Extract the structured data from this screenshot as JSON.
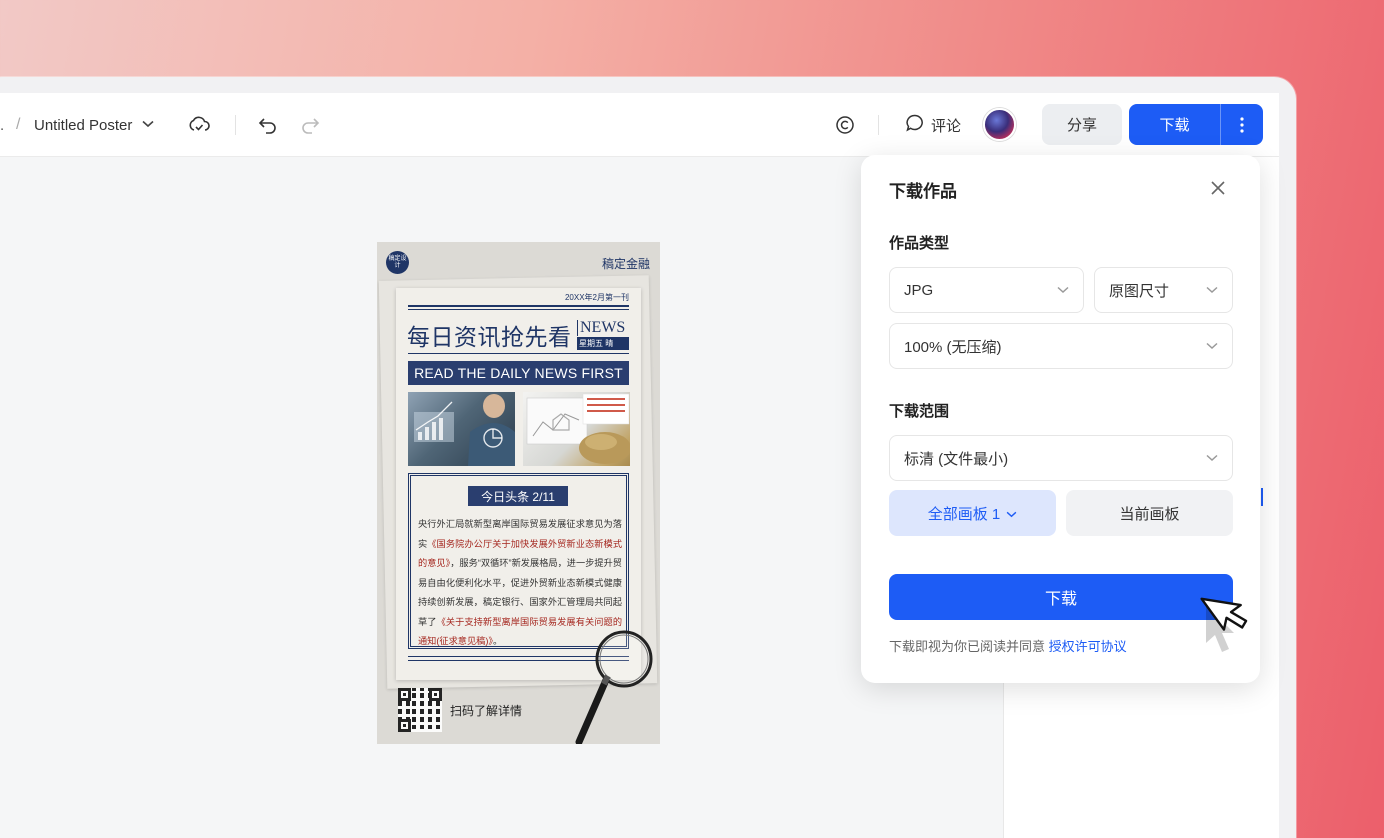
{
  "toolbar": {
    "breadcrumb_dot": ".",
    "breadcrumb_sep": "/",
    "title": "Untitled Poster",
    "comment_label": "评论",
    "share_label": "分享",
    "download_label": "下载"
  },
  "poster": {
    "logo_text": "稿定设计",
    "brand": "稿定金融",
    "issue": "20XX年2月第一刊",
    "headline": "每日资讯抢先看",
    "news_word": "NEWS",
    "news_sub": "星期五 晴",
    "banner": "READ THE DAILY NEWS FIRST",
    "today_label": "今日头条 2/11",
    "body_1": "央行外汇局就新型离岸国际贸易发展征求意见为落实",
    "body_red_1": "《国务院办公厅关于加快发展外贸新业态新模式的意见》",
    "body_2": "，服务“双循环”新发展格局，进一步提升贸易自由化便利化水平，促进外贸新业态新模式健康持续创新发展，稿定银行、国家外汇管理局共同起草了",
    "body_red_2": "《关于支持新型离岸国际贸易发展有关问题的通知(征求意见稿)》",
    "body_3": "。",
    "scan_label": "扫码了解详情"
  },
  "download_panel": {
    "title": "下载作品",
    "type_label": "作品类型",
    "format": "JPG",
    "size": "原图尺寸",
    "quality": "100% (无压缩)",
    "range_label": "下载范围",
    "resolution": "标清 (文件最小)",
    "all_boards": "全部画板 1",
    "current_board": "当前画板",
    "download_button": "下载",
    "agree_text": "下载即视为你已阅读并同意 ",
    "agree_link": "授权许可协议"
  },
  "colors": {
    "accent": "#1d5cf5",
    "poster_navy": "#1f3566",
    "poster_red": "#a5271f"
  },
  "icons": [
    "cloud-sync-icon",
    "undo-icon",
    "redo-icon",
    "copyright-icon",
    "comment-icon",
    "more-vertical-icon",
    "close-icon",
    "chevron-down-icon",
    "cursor-icon",
    "magnifier-icon"
  ]
}
